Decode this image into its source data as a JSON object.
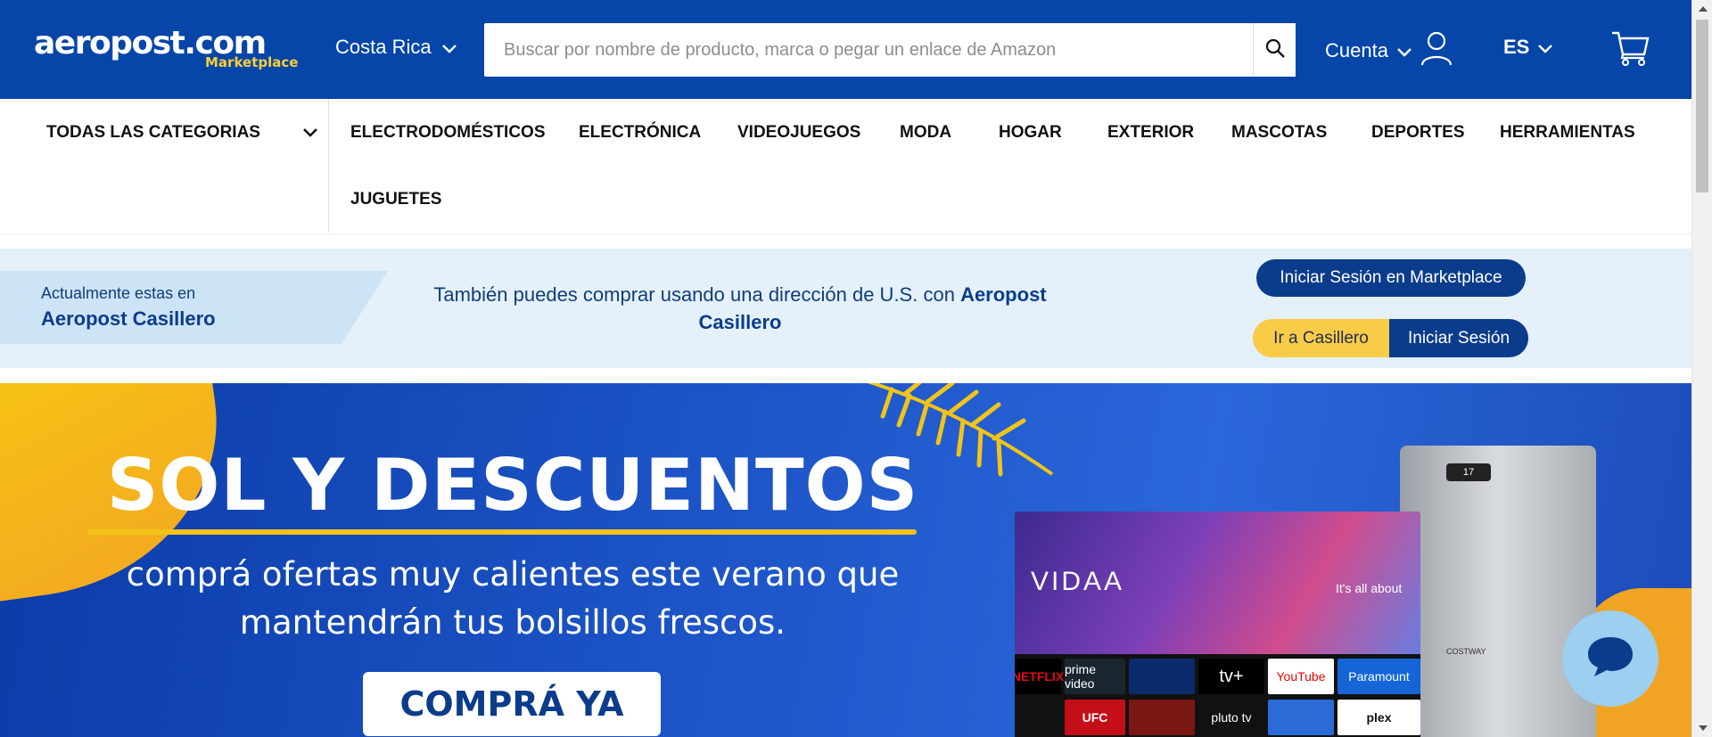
{
  "header": {
    "logo_text": "aeropost.com",
    "logo_sub": "Marketplace",
    "country": "Costa Rica",
    "search_placeholder": "Buscar por nombre de producto, marca o pegar un enlace de Amazon",
    "account_label": "Cuenta",
    "language": "ES",
    "colors": {
      "header_bg": "#0546a8",
      "accent_yellow": "#f9cf3a"
    },
    "icons": [
      "chevron-down-icon",
      "search-icon",
      "user-icon",
      "cart-icon"
    ]
  },
  "nav": {
    "all_categories": "TODAS LAS CATEGORIAS",
    "categories": [
      "ELECTRODOMÉSTICOS",
      "ELECTRÓNICA",
      "VIDEOJUEGOS",
      "MODA",
      "HOGAR",
      "EXTERIOR",
      "MASCOTAS",
      "DEPORTES",
      "HERRAMIENTAS",
      "JUGUETES"
    ]
  },
  "casillero": {
    "currently_label": "Actualmente estas en",
    "current_name": "Aeropost Casillero",
    "message_prefix": "También puedes comprar usando una dirección de U.S. con",
    "message_strong": "Aeropost Casillero",
    "marketplace_login": "Iniciar Sesión en Marketplace",
    "go_casillero": "Ir a Casillero",
    "login": "Iniciar Sesión"
  },
  "hero": {
    "title": "SOL Y DESCUENTOS",
    "subtitle_line1": "comprá ofertas muy calientes este verano que",
    "subtitle_line2": "mantendrán tus bolsillos frescos.",
    "cta": "COMPRÁ YA",
    "tv_brand": "VIDAA",
    "tv_tagline": "It's all about",
    "ac_brand": "COSTWAY",
    "apps": [
      "NETFLIX",
      "prime video",
      "",
      "tv+",
      "YouTube",
      "Paramount",
      "UFC",
      "",
      "pluto tv",
      "",
      "plex"
    ]
  },
  "chat": {
    "icon": "chat-bubble-icon"
  }
}
